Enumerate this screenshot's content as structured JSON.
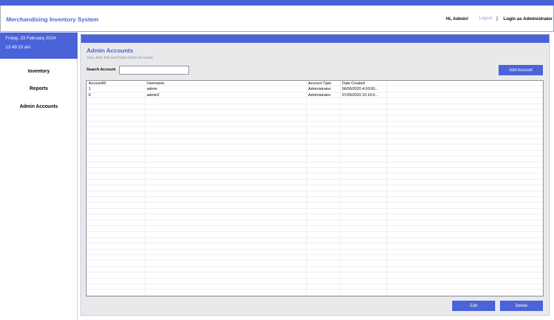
{
  "app": {
    "title": "Merchandising Inventory System",
    "greeting": "Hi, Admin!",
    "logout_label": "Logout",
    "separator": "|",
    "login_status": "Login as Administrator"
  },
  "sidebar": {
    "date": "Friday, 23 February 2024",
    "time": "12:49:23 am",
    "items": [
      {
        "label": "Inventory"
      },
      {
        "label": "Reports"
      },
      {
        "label": "Admin Accounts"
      }
    ]
  },
  "page": {
    "title": "Admin Accounts",
    "subtitle": "View, Add, Edit and Delete Admin Accounts"
  },
  "search": {
    "label": "Search Account",
    "value": "",
    "placeholder": ""
  },
  "buttons": {
    "add": "Add Account",
    "edit": "Edit",
    "delete": "Delete"
  },
  "table": {
    "columns": [
      "AccountID",
      "Username",
      "Account Type",
      "Date Created"
    ],
    "rows": [
      [
        "1",
        "admin",
        "Administrator",
        "06/05/2020 4:03:50..."
      ],
      [
        "6",
        "admin2",
        "Administrator",
        "07/05/2020 10:10:0..."
      ]
    ]
  },
  "colors": {
    "accent": "#4a63d9",
    "panel_background": "#e9e9ec"
  }
}
